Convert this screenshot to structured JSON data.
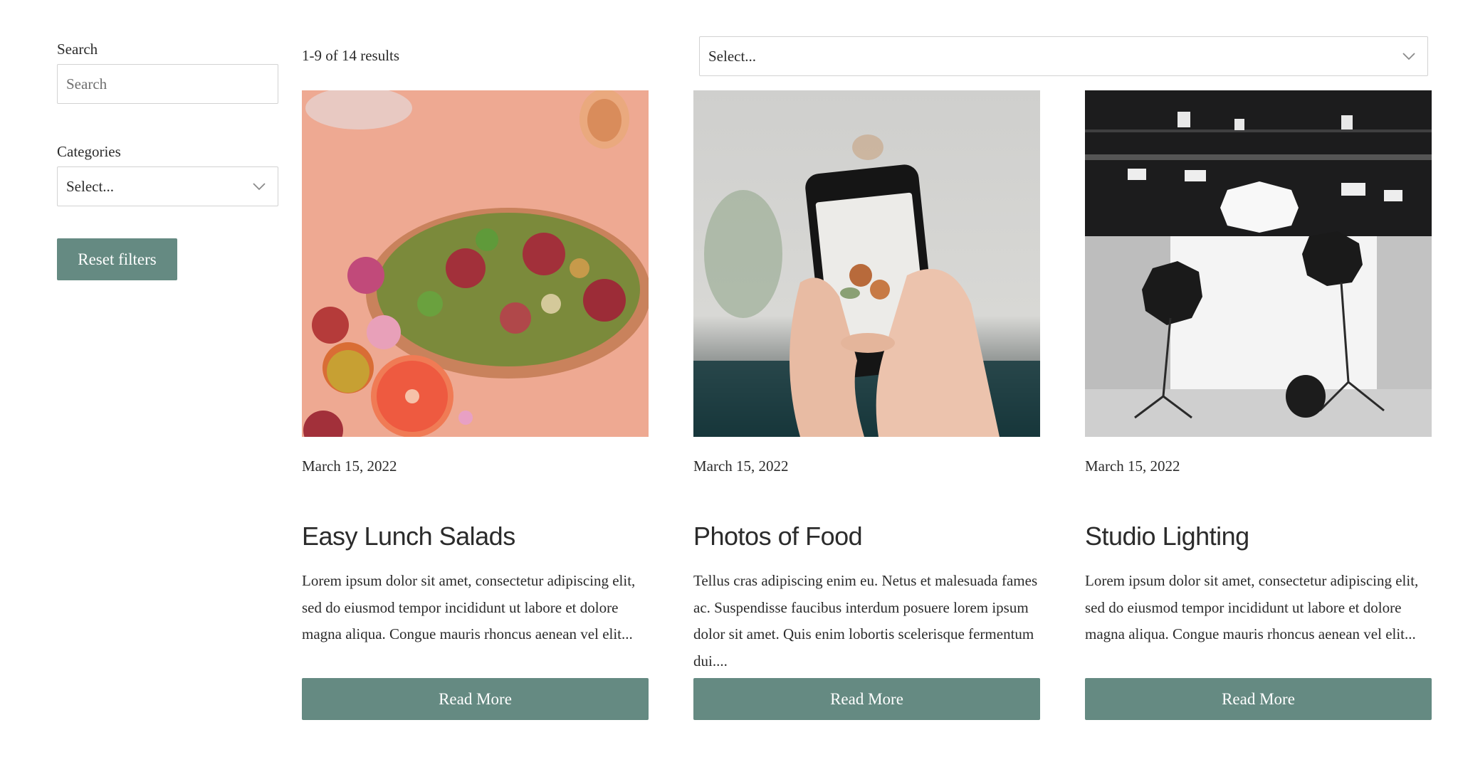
{
  "sidebar": {
    "search_label": "Search",
    "search_placeholder": "Search",
    "search_value": "",
    "categories_label": "Categories",
    "categories_selected": "Select...",
    "reset_label": "Reset filters"
  },
  "results": {
    "count_text": "1-9 of 14 results",
    "sort_selected": "Select..."
  },
  "colors": {
    "accent": "#658a82",
    "text": "#2b2b2b",
    "border": "#d2d2d2"
  },
  "posts": [
    {
      "date": "March 15, 2022",
      "title": "Easy Lunch Salads",
      "excerpt": "Lorem ipsum dolor sit amet, consectetur adipiscing elit, sed do eiusmod tempor incididunt ut labore et dolore magna aliqua. Congue mauris rhoncus aenean vel elit...",
      "button_label": "Read More",
      "image": "salad-bowl-photo"
    },
    {
      "date": "March 15, 2022",
      "title": "Photos of Food",
      "excerpt": "Tellus cras adipiscing enim eu. Netus et malesuada fames ac. Suspendisse faucibus interdum posuere lorem ipsum dolor sit amet. Quis enim lobortis scelerisque fermentum dui....",
      "button_label": "Read More",
      "image": "phone-photographing-food-photo"
    },
    {
      "date": "March 15, 2022",
      "title": "Studio Lighting",
      "excerpt": "Lorem ipsum dolor sit amet, consectetur adipiscing elit, sed do eiusmod tempor incididunt ut labore et dolore magna aliqua. Congue mauris rhoncus aenean vel elit...",
      "button_label": "Read More",
      "image": "photo-studio-lighting-photo"
    }
  ]
}
